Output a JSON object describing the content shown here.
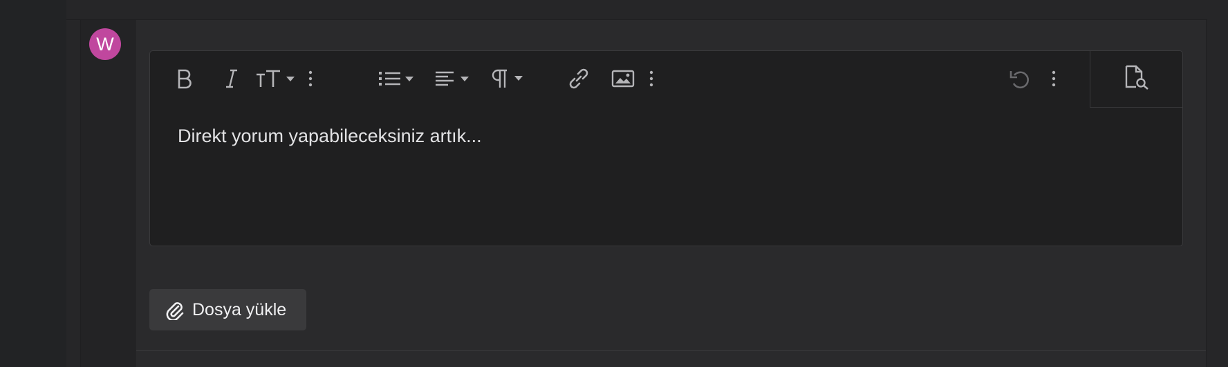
{
  "header": {
    "link_text": "· · · · · · · · · · · · ·"
  },
  "user": {
    "avatar_initial": "W",
    "avatar_color": "#c0479e"
  },
  "editor": {
    "content": "Direkt yorum yapabileceksiniz artık...",
    "toolbar": [
      {
        "icon": "bold-icon"
      },
      {
        "icon": "italic-icon"
      },
      {
        "icon": "font-size-icon"
      },
      {
        "icon": "more-text-icon"
      },
      {
        "icon": "list-icon"
      },
      {
        "icon": "align-icon"
      },
      {
        "icon": "paragraph-icon"
      },
      {
        "icon": "link-icon"
      },
      {
        "icon": "image-icon"
      },
      {
        "icon": "more-insert-icon"
      },
      {
        "icon": "undo-icon"
      },
      {
        "icon": "more-options-icon"
      },
      {
        "icon": "preview-icon"
      }
    ]
  },
  "upload": {
    "label": "Dosya yükle",
    "icon": "paperclip-icon"
  },
  "colors": {
    "background": "#222325",
    "panel": "#2a2a2c",
    "editor_bg": "#1f1f20",
    "text": "#e2e2e4",
    "icon": "#b5b5b8",
    "button_bg": "#3a3a3c"
  }
}
